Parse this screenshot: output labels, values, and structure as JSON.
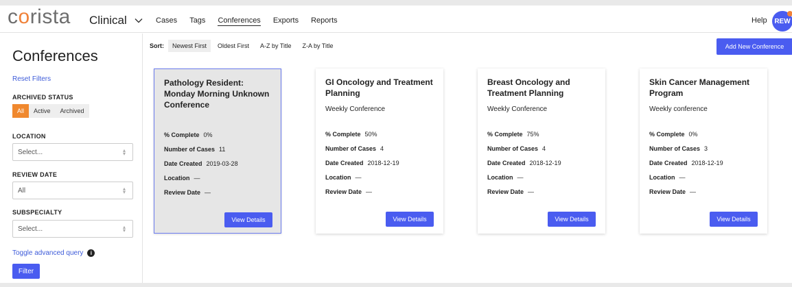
{
  "header": {
    "logo_prefix": "c",
    "logo_o": "o",
    "logo_suffix": "rista",
    "app_name": "Clinical",
    "nav": [
      "Cases",
      "Tags",
      "Conferences",
      "Exports",
      "Reports"
    ],
    "active_nav": "Conferences",
    "help_label": "Help",
    "avatar_initials": "REW",
    "accent_color": "#4a5cf0",
    "brand_color": "#f0823a"
  },
  "sidebar": {
    "page_title": "Conferences",
    "reset_filters": "Reset Filters",
    "archived_status_label": "ARCHIVED STATUS",
    "archived_options": [
      "All",
      "Active",
      "Archived"
    ],
    "archived_selected": "All",
    "location_label": "LOCATION",
    "location_value": "Select...",
    "review_date_label": "REVIEW DATE",
    "review_date_value": "All",
    "subspecialty_label": "SUBSPECIALTY",
    "subspecialty_value": "Select...",
    "toggle_query": "Toggle advanced query",
    "info_glyph": "i",
    "filter_button": "Filter"
  },
  "main": {
    "sort_label": "Sort:",
    "sort_options": [
      "Newest First",
      "Oldest First",
      "A-Z by Title",
      "Z-A by Title"
    ],
    "sort_selected": "Newest First",
    "add_button": "Add New Conference",
    "field_labels": {
      "complete": "% Complete",
      "cases": "Number of Cases",
      "created": "Date Created",
      "location": "Location",
      "review": "Review Date"
    },
    "view_details": "View Details",
    "cards": [
      {
        "title": "Pathology Resident: Monday Morning Unknown Conference",
        "subtitle": "",
        "complete": "0%",
        "cases": "11",
        "created": "2019-03-28",
        "location": "—",
        "review": "—",
        "selected": true
      },
      {
        "title": "GI Oncology and Treatment Planning",
        "subtitle": "Weekly Conference",
        "complete": "50%",
        "cases": "4",
        "created": "2018-12-19",
        "location": "—",
        "review": "—",
        "selected": false
      },
      {
        "title": "Breast Oncology and Treatment Planning",
        "subtitle": "Weekly Conference",
        "complete": "75%",
        "cases": "4",
        "created": "2018-12-19",
        "location": "—",
        "review": "—",
        "selected": false
      },
      {
        "title": "Skin Cancer Management Program",
        "subtitle": "Weekly conference",
        "complete": "0%",
        "cases": "3",
        "created": "2018-12-19",
        "location": "—",
        "review": "—",
        "selected": false
      }
    ]
  }
}
